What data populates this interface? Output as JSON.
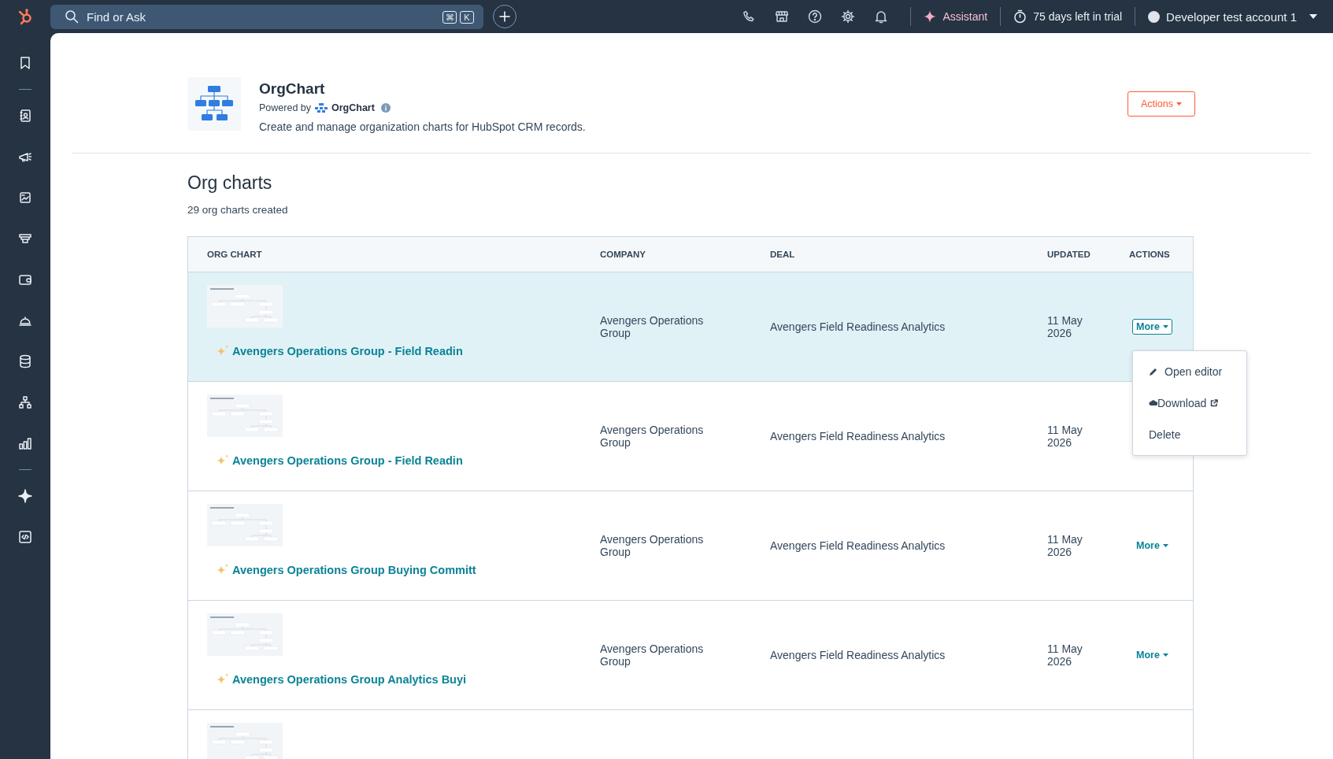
{
  "topbar": {
    "search": {
      "placeholder": "Find or Ask"
    },
    "shortcut_keys": [
      "⌘",
      "K"
    ],
    "assistant": "Assistant",
    "trial": "75 days left in trial",
    "account": "Developer test account 1"
  },
  "app": {
    "title": "OrgChart",
    "powered_by": "Powered by",
    "brand": "OrgChart",
    "description": "Create and manage organization charts for HubSpot CRM records.",
    "actions_button": "Actions"
  },
  "section": {
    "title": "Org charts",
    "count": "29 org charts created"
  },
  "table": {
    "columns": [
      "ORG CHART",
      "COMPANY",
      "DEAL",
      "UPDATED",
      "ACTIONS"
    ],
    "rows": [
      {
        "selected": true,
        "expanded": true,
        "name": "Avengers Operations Group - Field Readin",
        "company": "Avengers Operations Group",
        "deal": "Avengers Field Readiness Analytics",
        "updated": "11 May 2026",
        "action": "More"
      },
      {
        "selected": false,
        "name": "Avengers Operations Group - Field Readin",
        "company": "Avengers Operations Group",
        "deal": "Avengers Field Readiness Analytics",
        "updated": "11 May 2026"
      },
      {
        "selected": false,
        "expanded": false,
        "name": "Avengers Operations Group Buying Committ",
        "company": "Avengers Operations Group",
        "deal": "Avengers Field Readiness Analytics",
        "updated": "11 May 2026",
        "action": "More"
      },
      {
        "selected": false,
        "expanded": false,
        "name": "Avengers Operations Group Analytics Buyi",
        "company": "Avengers Operations Group",
        "deal": "Avengers Field Readiness Analytics",
        "updated": "11 May 2026",
        "action": "More"
      },
      {
        "selected": false
      }
    ],
    "menu": {
      "items": [
        {
          "kind": "edit",
          "label": "Open editor"
        },
        {
          "kind": "download",
          "label": "Download"
        },
        {
          "kind": "plain",
          "label": "Delete"
        }
      ]
    }
  }
}
